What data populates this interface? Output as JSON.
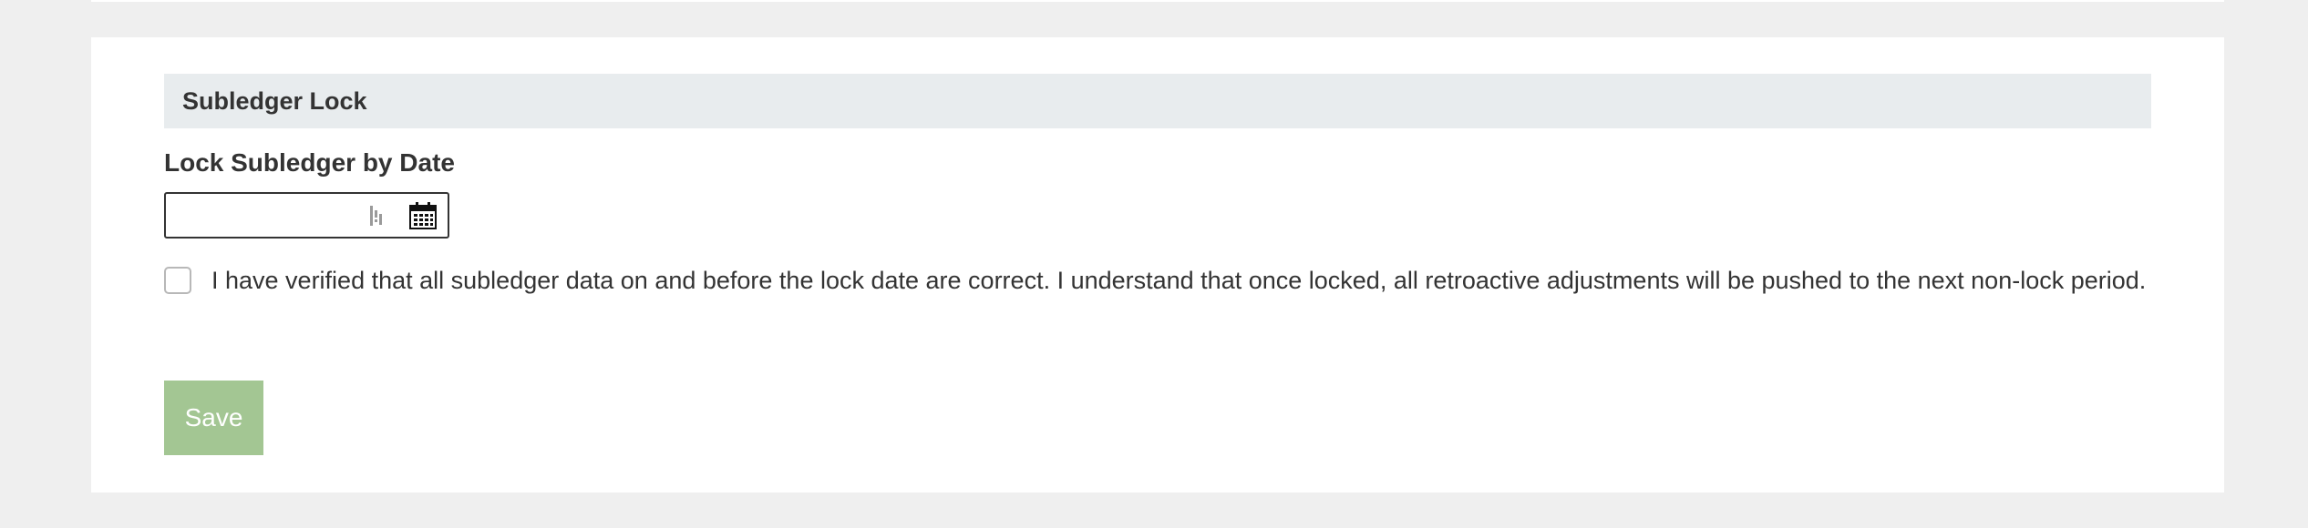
{
  "section": {
    "title": "Subledger Lock"
  },
  "lock_date": {
    "label": "Lock Subledger by Date",
    "value": "",
    "placeholder": ""
  },
  "icons": {
    "clear": "clear-icon",
    "calendar": "calendar-icon"
  },
  "confirmation": {
    "checked": false,
    "text": "I have verified that all subledger data on and before the lock date are correct. I understand that once locked, all retroactive adjustments will be pushed to the next non-lock period."
  },
  "actions": {
    "save_label": "Save"
  },
  "colors": {
    "page_background": "#efefef",
    "panel_background": "#ffffff",
    "header_background": "#e8ecee",
    "save_button": "#a3c693",
    "text": "#333333"
  }
}
